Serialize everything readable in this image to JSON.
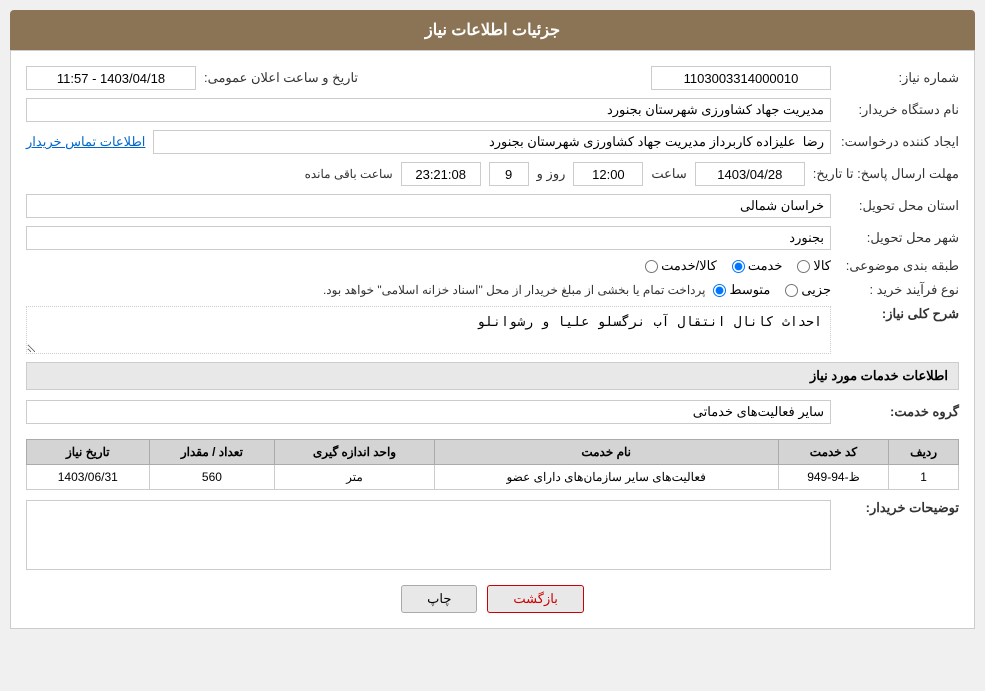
{
  "header": {
    "title": "جزئیات اطلاعات نیاز"
  },
  "form": {
    "shomareNiaz_label": "شماره نیاز:",
    "shomareNiaz_value": "1103003314000010",
    "tarikh_label": "تاریخ و ساعت اعلان عمومی:",
    "tarikh_value": "1403/04/18 - 11:57",
    "namDastgah_label": "نام دستگاه خریدار:",
    "namDastgah_value": "مدیریت جهاد کشاورزی شهرستان بجنورد",
    "ijadKonande_label": "ایجاد کننده درخواست:",
    "ijadKonande_value": "رضا  علیزاده کاربرداز مدیریت جهاد کشاورزی شهرستان بجنورد",
    "etelaat_link": "اطلاعات تماس خریدار",
    "mohlat_label": "مهلت ارسال پاسخ: تا تاریخ:",
    "mohlat_date": "1403/04/28",
    "mohlat_saat_label": "ساعت",
    "mohlat_saat_value": "12:00",
    "mohlat_roz_label": "روز و",
    "mohlat_roz_value": "9",
    "mohlat_mande_label": "ساعت باقی مانده",
    "mohlat_mande_value": "23:21:08",
    "ostan_label": "استان محل تحویل:",
    "ostan_value": "خراسان شمالی",
    "shahr_label": "شهر محل تحویل:",
    "shahr_value": "بجنورد",
    "tabaqe_label": "طبقه بندی موضوعی:",
    "tabaqe_options": [
      {
        "id": "kala",
        "label": "کالا"
      },
      {
        "id": "khedmat",
        "label": "خدمت"
      },
      {
        "id": "kala_khedmat",
        "label": "کالا/خدمت"
      }
    ],
    "tabaqe_selected": "khedmat",
    "noefarayand_label": "نوع فرآیند خرید :",
    "noefarayand_options": [
      {
        "id": "jozii",
        "label": "جزیی"
      },
      {
        "id": "motevaset",
        "label": "متوسط"
      }
    ],
    "noefarayand_selected": "motevaset",
    "noefarayand_note": "پرداخت تمام یا بخشی از مبلغ خریدار از محل \"اسناد خزانه اسلامی\" خواهد بود.",
    "sharh_label": "شرح کلی نیاز:",
    "sharh_value": "احداث کانال انتقال آب نرگسلو علیا و رشوانلو",
    "khadamat_label": "اطلاعات خدمات مورد نیاز",
    "grohe_label": "گروه خدمت:",
    "grohe_value": "سایر فعالیت‌های خدماتی",
    "table": {
      "headers": [
        "ردیف",
        "کد خدمت",
        "نام خدمت",
        "واحد اندازه گیری",
        "تعداد / مقدار",
        "تاریخ نیاز"
      ],
      "rows": [
        {
          "radif": "1",
          "kod": "ظ-94-949",
          "name": "فعالیت‌های سایر سازمان‌های دارای عضو",
          "vahed": "متر",
          "tedad": "560",
          "tarikh": "1403/06/31"
        }
      ]
    },
    "tozihat_label": "توضیحات خریدار:",
    "tozihat_value": "",
    "btn_print": "چاپ",
    "btn_back": "بازگشت"
  }
}
